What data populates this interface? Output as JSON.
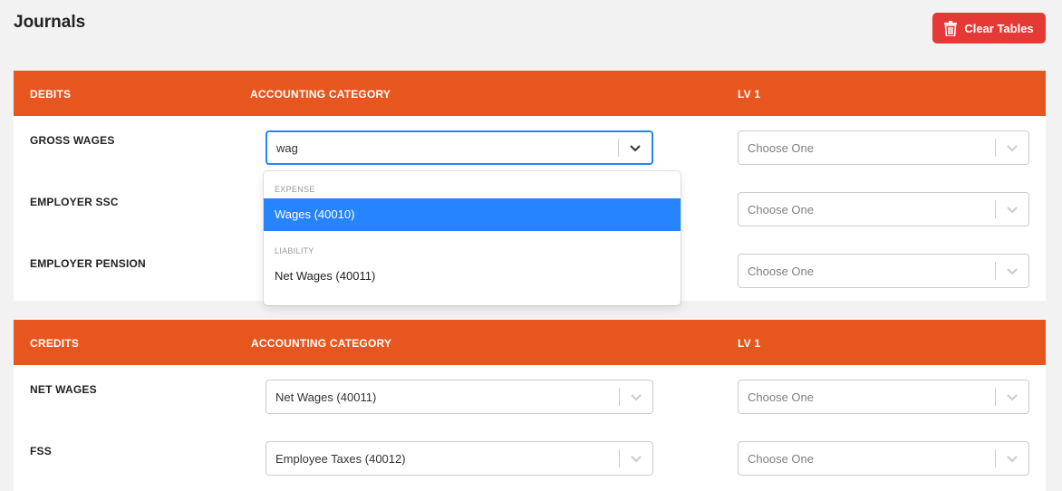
{
  "page": {
    "title": "Journals"
  },
  "toolbar": {
    "clear_label": "Clear Tables"
  },
  "debits": {
    "headers": [
      "DEBITS",
      "ACCOUNTING CATEGORY",
      "LV 1"
    ],
    "rows": [
      {
        "label": "GROSS WAGES",
        "category_value": "wag",
        "lv1_placeholder": "Choose One"
      },
      {
        "label": "EMPLOYER SSC",
        "lv1_placeholder": "Choose One"
      },
      {
        "label": "EMPLOYER PENSION",
        "lv1_placeholder": "Choose One"
      }
    ]
  },
  "dropdown": {
    "groups": [
      {
        "label": "EXPENSE",
        "options": [
          {
            "label": "Wages (40010)",
            "highlighted": true
          }
        ]
      },
      {
        "label": "LIABILITY",
        "options": [
          {
            "label": "Net Wages (40011)",
            "highlighted": false
          }
        ]
      }
    ]
  },
  "credits": {
    "headers": [
      "CREDITS",
      "ACCOUNTING CATEGORY",
      "LV 1"
    ],
    "rows": [
      {
        "label": "NET WAGES",
        "category_value": "Net Wages (40011)",
        "lv1_placeholder": "Choose One"
      },
      {
        "label": "FSS",
        "category_value": "Employee Taxes (40012)",
        "lv1_placeholder": "Choose One"
      }
    ]
  },
  "colors": {
    "header": "#e8561f",
    "danger": "#e53935",
    "focus": "#2684ff"
  },
  "icons": {
    "clear": "trash-icon",
    "dropdown": "chevron-down-icon"
  }
}
